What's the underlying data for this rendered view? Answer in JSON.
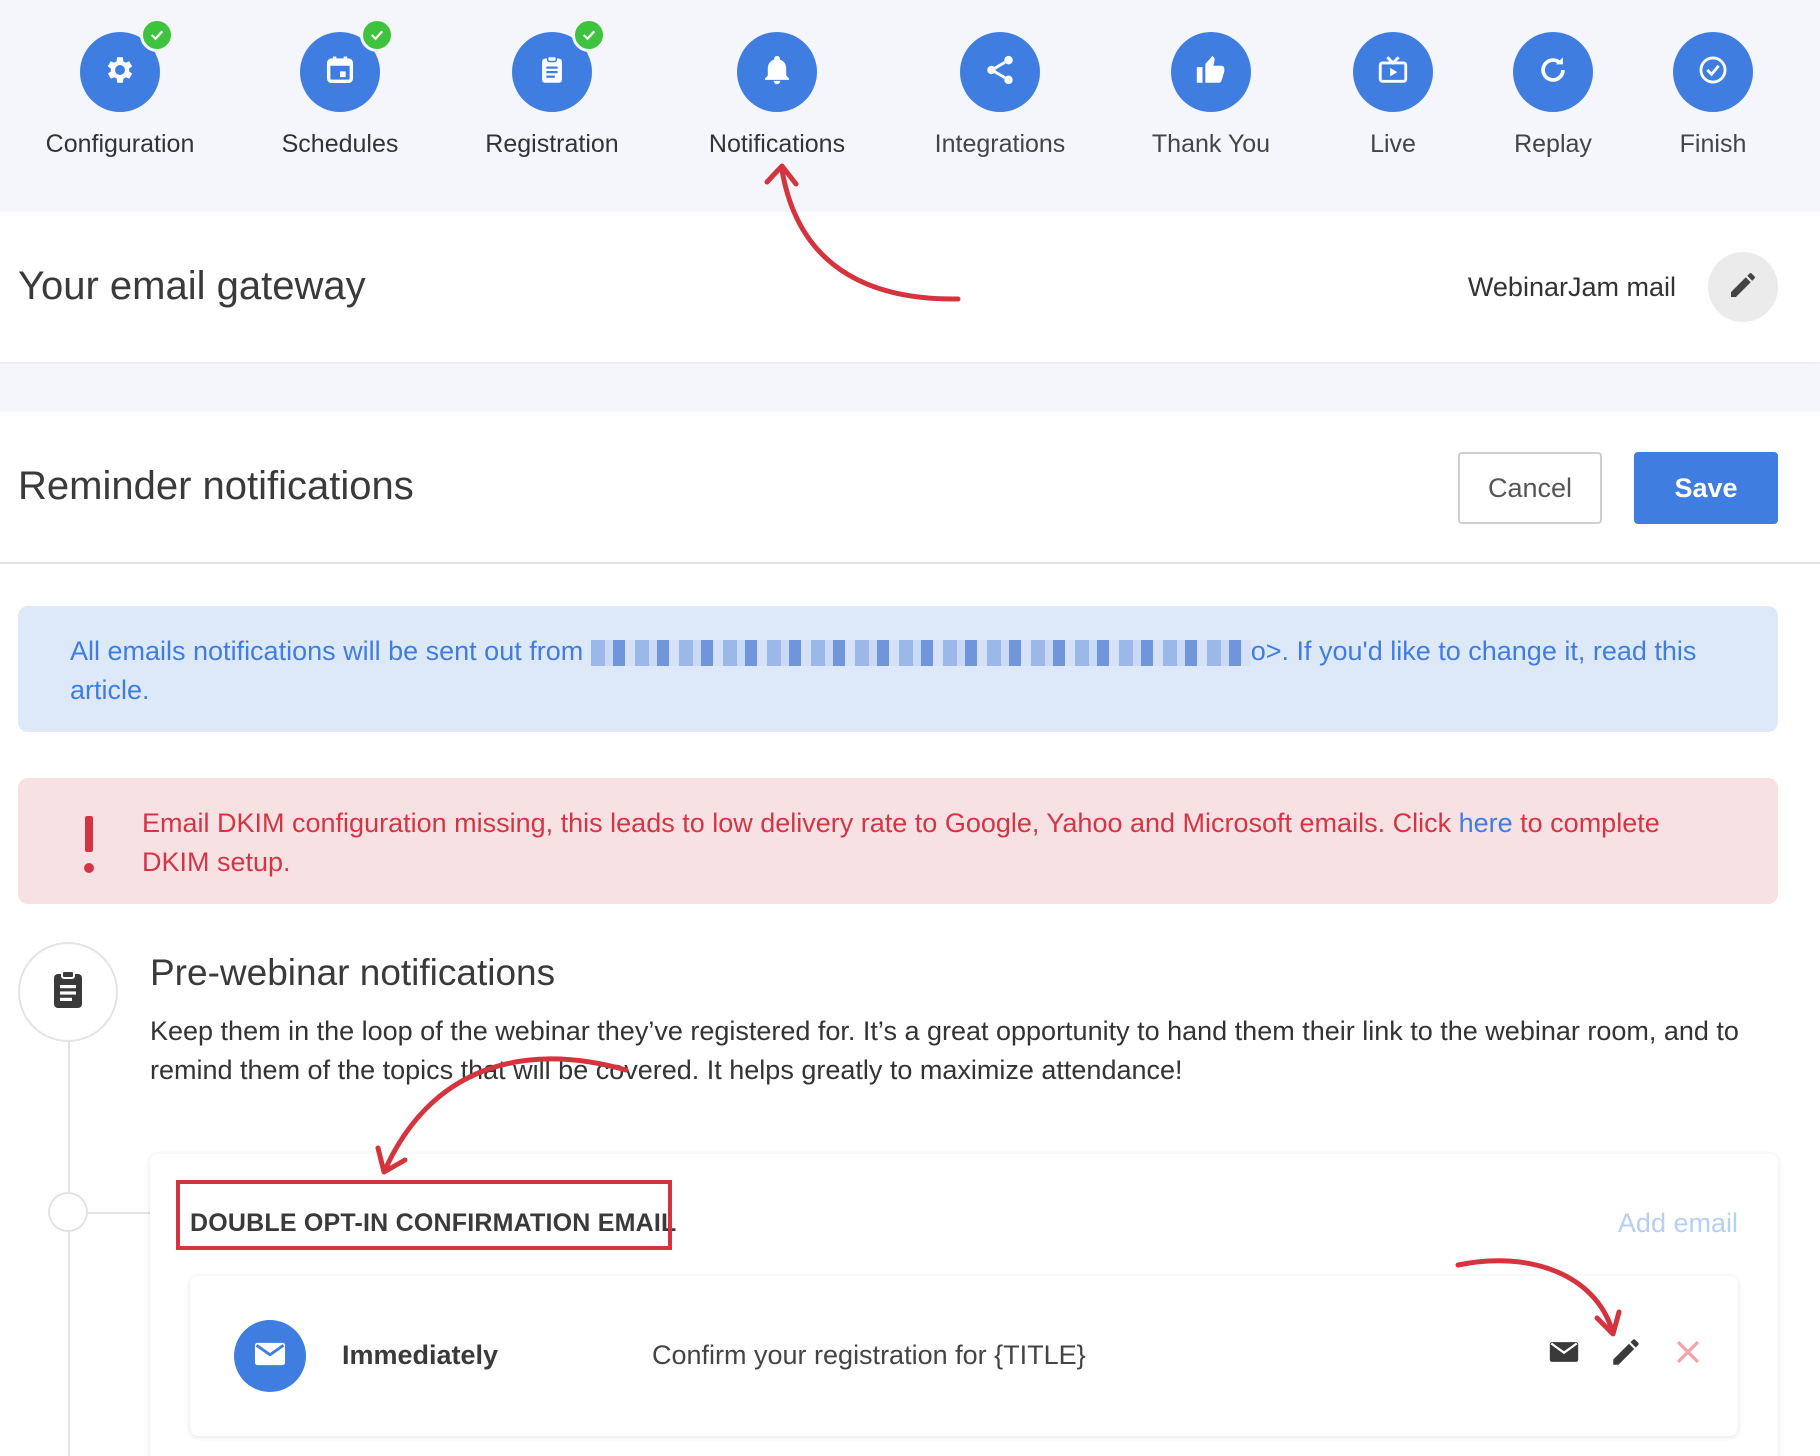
{
  "stepper": {
    "steps": [
      {
        "label": "Configuration",
        "icon": "gear-icon",
        "done": true
      },
      {
        "label": "Schedules",
        "icon": "calendar-icon",
        "done": true
      },
      {
        "label": "Registration",
        "icon": "clipboard-icon",
        "done": true
      },
      {
        "label": "Notifications",
        "icon": "bell-icon",
        "done": false,
        "active": true
      },
      {
        "label": "Integrations",
        "icon": "share-icon",
        "done": false
      },
      {
        "label": "Thank You",
        "icon": "thumbs-up-icon",
        "done": false
      },
      {
        "label": "Live",
        "icon": "live-tv-icon",
        "done": false
      },
      {
        "label": "Replay",
        "icon": "replay-icon",
        "done": false
      },
      {
        "label": "Finish",
        "icon": "check-circle-icon",
        "done": false
      }
    ]
  },
  "gateway": {
    "title": "Your email gateway",
    "value": "WebinarJam mail"
  },
  "reminder": {
    "title": "Reminder notifications",
    "cancel_label": "Cancel",
    "save_label": "Save",
    "info_prefix": "All emails notifications will be sent out from",
    "info_suffix": "o>. If you'd like to change it, read this article.",
    "alert_text": "Email DKIM configuration missing, this leads to low delivery rate to Google, Yahoo and Microsoft emails. Click",
    "alert_link": "here",
    "alert_suffix": "to complete DKIM setup."
  },
  "pre_webinar": {
    "title": "Pre-webinar notifications",
    "description": "Keep them in the loop of the webinar they’ve registered for. It’s a great opportunity to hand them their link to the webinar room, and to remind them of the topics that will be covered. It helps greatly to maximize attendance!",
    "group": {
      "title": "DOUBLE OPT-IN CONFIRMATION EMAIL",
      "add_label": "Add email",
      "rows": [
        {
          "timing": "Immediately",
          "subject": "Confirm your registration for {TITLE}"
        }
      ]
    }
  },
  "colors": {
    "accent": "#3f7ee0",
    "success": "#3fc33f",
    "danger": "#d43545",
    "annotation": "#d4343e"
  }
}
